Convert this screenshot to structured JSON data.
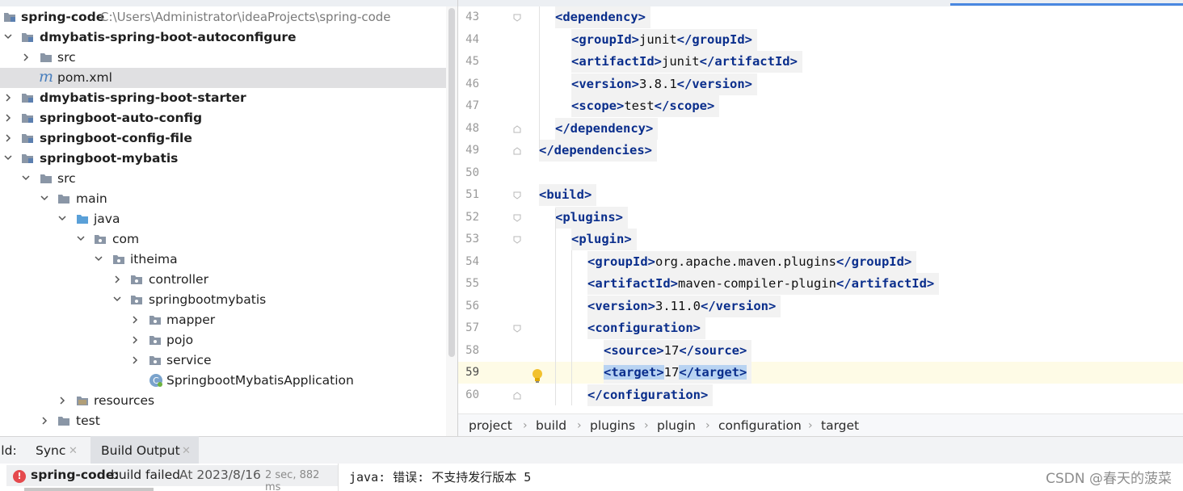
{
  "project_tree": {
    "rows": [
      {
        "label": "spring-code",
        "path": "C:\\Users\\Administrator\\ideaProjects\\spring-code",
        "bold": true
      },
      {
        "label": "dmybatis-spring-boot-autoconfigure",
        "bold": true
      },
      {
        "label": "src",
        "bold": false
      },
      {
        "label": "pom.xml",
        "bold": false
      },
      {
        "label": "dmybatis-spring-boot-starter",
        "bold": true
      },
      {
        "label": "springboot-auto-config",
        "bold": true
      },
      {
        "label": "springboot-config-file",
        "bold": true
      },
      {
        "label": "springboot-mybatis",
        "bold": true
      },
      {
        "label": "src",
        "bold": false
      },
      {
        "label": "main",
        "bold": false
      },
      {
        "label": "java",
        "bold": false
      },
      {
        "label": "com",
        "bold": false
      },
      {
        "label": "itheima",
        "bold": false
      },
      {
        "label": "controller",
        "bold": false
      },
      {
        "label": "springbootmybatis",
        "bold": false
      },
      {
        "label": "mapper",
        "bold": false
      },
      {
        "label": "pojo",
        "bold": false
      },
      {
        "label": "service",
        "bold": false
      },
      {
        "label": "SpringbootMybatisApplication",
        "bold": false
      },
      {
        "label": "resources",
        "bold": false
      },
      {
        "label": "test",
        "bold": false
      }
    ]
  },
  "editor": {
    "lines": [
      {
        "num": "43",
        "tokens": [
          [
            "t",
            "<dependency>"
          ]
        ]
      },
      {
        "num": "44",
        "tokens": [
          [
            "t",
            "<groupId>"
          ],
          [
            "p",
            "junit"
          ],
          [
            "t",
            "</groupId>"
          ]
        ]
      },
      {
        "num": "45",
        "tokens": [
          [
            "t",
            "<artifactId>"
          ],
          [
            "p",
            "junit"
          ],
          [
            "t",
            "</artifactId>"
          ]
        ]
      },
      {
        "num": "46",
        "tokens": [
          [
            "t",
            "<version>"
          ],
          [
            "p",
            "3.8.1"
          ],
          [
            "t",
            "</version>"
          ]
        ]
      },
      {
        "num": "47",
        "tokens": [
          [
            "t",
            "<scope>"
          ],
          [
            "p",
            "test"
          ],
          [
            "t",
            "</scope>"
          ]
        ]
      },
      {
        "num": "48",
        "tokens": [
          [
            "t",
            "</dependency>"
          ]
        ]
      },
      {
        "num": "49",
        "tokens": [
          [
            "t",
            "</dependencies>"
          ]
        ]
      },
      {
        "num": "50",
        "tokens": []
      },
      {
        "num": "51",
        "tokens": [
          [
            "t",
            "<build>"
          ]
        ]
      },
      {
        "num": "52",
        "tokens": [
          [
            "t",
            "<plugins>"
          ]
        ]
      },
      {
        "num": "53",
        "tokens": [
          [
            "t",
            "<plugin>"
          ]
        ]
      },
      {
        "num": "54",
        "tokens": [
          [
            "t",
            "<groupId>"
          ],
          [
            "p",
            "org.apache.maven.plugins"
          ],
          [
            "t",
            "</groupId>"
          ]
        ]
      },
      {
        "num": "55",
        "tokens": [
          [
            "t",
            "<artifactId>"
          ],
          [
            "p",
            "maven-compiler-plugin"
          ],
          [
            "t",
            "</artifactId>"
          ]
        ]
      },
      {
        "num": "56",
        "tokens": [
          [
            "t",
            "<version>"
          ],
          [
            "p",
            "3.11.0"
          ],
          [
            "t",
            "</version>"
          ]
        ]
      },
      {
        "num": "57",
        "tokens": [
          [
            "t",
            "<configuration>"
          ]
        ]
      },
      {
        "num": "58",
        "tokens": [
          [
            "t",
            "<source>"
          ],
          [
            "p",
            "17"
          ],
          [
            "t",
            "</source>"
          ]
        ]
      },
      {
        "num": "59",
        "tokens": [
          [
            "th",
            "<target>"
          ],
          [
            "p",
            "17"
          ],
          [
            "th",
            "</target>"
          ]
        ]
      },
      {
        "num": "60",
        "tokens": [
          [
            "t",
            "</configuration>"
          ]
        ]
      }
    ]
  },
  "breadcrumb": [
    "project",
    "build",
    "plugins",
    "plugin",
    "configuration",
    "target"
  ],
  "build_panel": {
    "prefix": "ild:",
    "tabs": [
      "Sync",
      "Build Output"
    ],
    "error_project": "spring-code:",
    "error_status": "build failed",
    "error_time": "At 2023/8/16",
    "error_duration": "2 sec, 882 ms",
    "output_message": "java: 错误: 不支持发行版本 5"
  },
  "watermark": "CSDN @春天的菠菜",
  "colors": {
    "tag": "#0a2e8c",
    "error": "#e5494d",
    "selection": "#b8d3f2",
    "current_line": "#fefbe6"
  }
}
